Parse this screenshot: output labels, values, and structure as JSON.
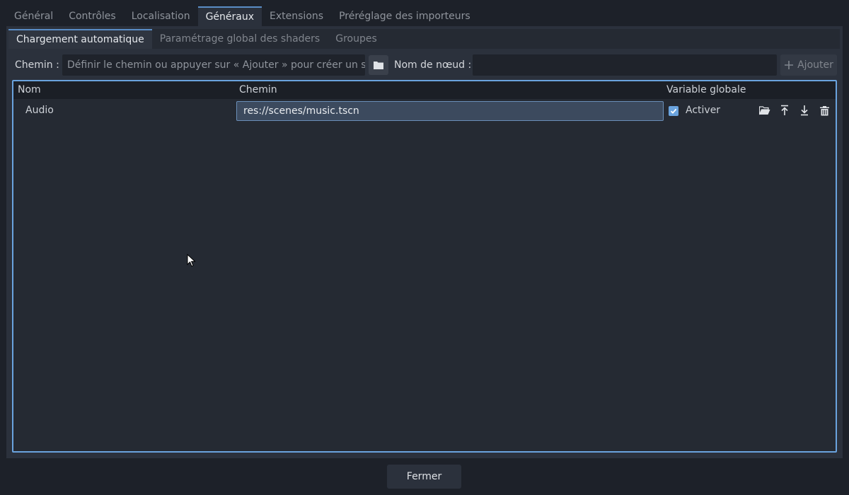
{
  "tabs": [
    {
      "label": "Général",
      "active": false
    },
    {
      "label": "Contrôles",
      "active": false
    },
    {
      "label": "Localisation",
      "active": false
    },
    {
      "label": "Généraux",
      "active": true
    },
    {
      "label": "Extensions",
      "active": false
    },
    {
      "label": "Préréglage des importeurs",
      "active": false
    }
  ],
  "subtabs": [
    {
      "label": "Chargement automatique",
      "active": true
    },
    {
      "label": "Paramétrage global des shaders",
      "active": false
    },
    {
      "label": "Groupes",
      "active": false
    }
  ],
  "path_row": {
    "path_label": "Chemin :",
    "path_placeholder": "Définir le chemin ou appuyer sur « Ajouter » pour créer un scri",
    "node_name_label": "Nom de nœud :",
    "node_name_value": "",
    "add_label": "Ajouter"
  },
  "table": {
    "columns": {
      "name": "Nom",
      "path": "Chemin",
      "global": "Variable globale"
    },
    "rows": [
      {
        "name": "Audio",
        "path": "res://scenes/music.tscn",
        "enabled": true,
        "enable_label": "Activer"
      }
    ]
  },
  "footer": {
    "close_label": "Fermer"
  },
  "colors": {
    "accent": "#6aa3de",
    "background": "#1d2129",
    "panel": "#2b313c"
  }
}
